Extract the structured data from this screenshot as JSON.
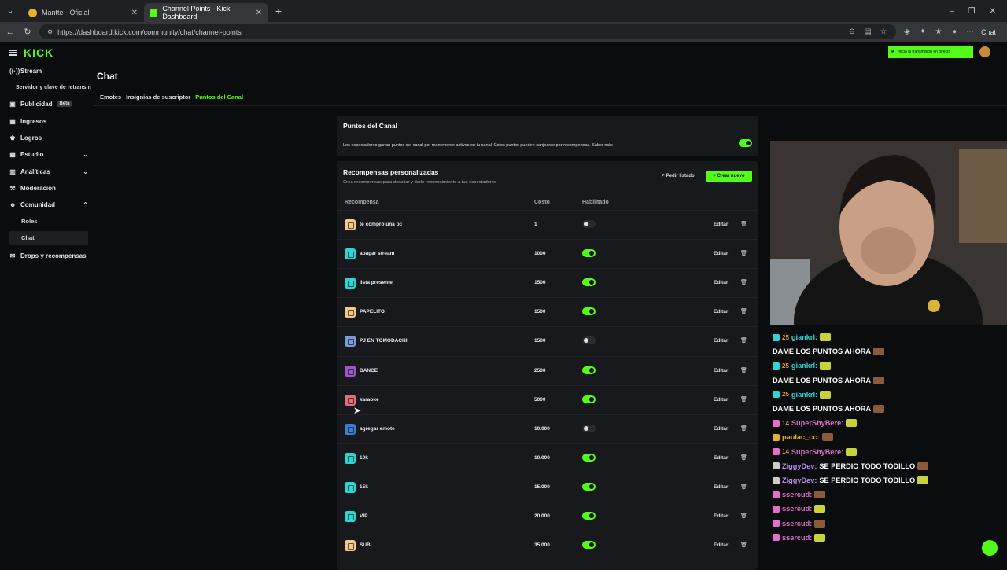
{
  "browser": {
    "tabs": [
      {
        "title": "Mantte - Oficial"
      },
      {
        "title": "Channel Points - Kick Dashboard"
      }
    ],
    "url": "https://dashboard.kick.com/community/chat/channel-points",
    "profile_label": "Chat"
  },
  "sidebar": {
    "logo": "KICK",
    "items": [
      {
        "label": "Stream"
      },
      {
        "label": "Servidor y clave de retransm"
      },
      {
        "label": "Publicidad",
        "badge": "Beta"
      },
      {
        "label": "Ingresos"
      },
      {
        "label": "Logros"
      },
      {
        "label": "Estudio"
      },
      {
        "label": "Analíticas"
      },
      {
        "label": "Moderación"
      },
      {
        "label": "Comunidad"
      },
      {
        "label": "Roles"
      },
      {
        "label": "Chat"
      },
      {
        "label": "Drops y recompensas"
      }
    ]
  },
  "header": {
    "title": "Chat",
    "tabs": [
      "Emotes",
      "Insignias de suscriptor",
      "Puntos del Canal"
    ],
    "cta": "Inicia la transmisión en directo"
  },
  "points_panel": {
    "title": "Puntos del Canal",
    "description": "Los espectadores ganan puntos del canal por mantenerse activos en tu canal. Estos puntos pueden canjearse por recompensas. Saber más",
    "enabled": true
  },
  "rewards_panel": {
    "title": "Recompensas personalizadas",
    "description": "Crea recompensas para desafiar y darle reconocimiento a tus espectadores",
    "list_button": "Pedir listado",
    "new_button": "Crear nuevo",
    "columns": [
      "Recompensa",
      "Costo",
      "Habilitado"
    ],
    "edit_label": "Editar",
    "rows": [
      {
        "name": "te compro una pc",
        "cost": "1",
        "enabled": false,
        "color": "#f5c98a"
      },
      {
        "name": "apagar stream",
        "cost": "1000",
        "enabled": true,
        "color": "#2fd4d4"
      },
      {
        "name": "lista presente",
        "cost": "1500",
        "enabled": true,
        "color": "#2fd4d4"
      },
      {
        "name": "PAPELITO",
        "cost": "1500",
        "enabled": true,
        "color": "#f5c98a"
      },
      {
        "name": "PJ EN TOMODACHI",
        "cost": "1500",
        "enabled": false,
        "color": "#7c9bd6"
      },
      {
        "name": "DANCE",
        "cost": "2500",
        "enabled": true,
        "color": "#9b59c9"
      },
      {
        "name": "karaoke",
        "cost": "5000",
        "enabled": true,
        "color": "#e0707a"
      },
      {
        "name": "agregar emote",
        "cost": "10.000",
        "enabled": false,
        "color": "#3f7fd1"
      },
      {
        "name": "10k",
        "cost": "10.000",
        "enabled": true,
        "color": "#2fd4d4"
      },
      {
        "name": "15k",
        "cost": "15.000",
        "enabled": true,
        "color": "#2fd4d4"
      },
      {
        "name": "VIP",
        "cost": "20.000",
        "enabled": true,
        "color": "#2fd4d4"
      },
      {
        "name": "SUB",
        "cost": "35.000",
        "enabled": true,
        "color": "#f5c98a"
      }
    ]
  },
  "chat": [
    {
      "badge": "25",
      "user": "giankrl:",
      "text": "",
      "color": "#2fd4d4"
    },
    {
      "badge": "",
      "user": "",
      "text": "DAME LOS PUNTOS AHORA",
      "color": ""
    },
    {
      "badge": "25",
      "user": "giankrl:",
      "text": "",
      "color": "#2fd4d4"
    },
    {
      "badge": "",
      "user": "",
      "text": "DAME LOS PUNTOS AHORA",
      "color": ""
    },
    {
      "badge": "25",
      "user": "giankrl:",
      "text": "",
      "color": "#2fd4d4"
    },
    {
      "badge": "",
      "user": "",
      "text": "DAME LOS PUNTOS AHORA",
      "color": ""
    },
    {
      "badge": "14",
      "user": "SuperShyBere:",
      "text": "",
      "color": "#e070c8"
    },
    {
      "badge": "",
      "user": "paulac_cc:",
      "text": "",
      "color": "#e6b02e"
    },
    {
      "badge": "14",
      "user": "SuperShyBere:",
      "text": "",
      "color": "#e070c8"
    },
    {
      "badge": "",
      "user": "ZiggyDev:",
      "text": "SE PERDIO TODO TODILLO",
      "color": "#cccccc"
    },
    {
      "badge": "",
      "user": "ZiggyDev:",
      "text": "SE PERDIO TODO TODILLO",
      "color": "#cccccc"
    },
    {
      "badge": "",
      "user": "ssercud:",
      "text": "",
      "color": "#e070c8"
    },
    {
      "badge": "",
      "user": "ssercud:",
      "text": "",
      "color": "#e070c8"
    },
    {
      "badge": "",
      "user": "ssercud:",
      "text": "",
      "color": "#e070c8"
    },
    {
      "badge": "",
      "user": "ssercud:",
      "text": "",
      "color": "#e070c8"
    }
  ]
}
